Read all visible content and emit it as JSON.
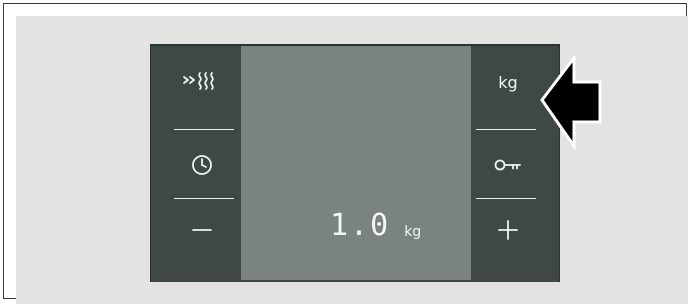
{
  "panel": {
    "left_buttons": [
      {
        "id": "speed",
        "icon": "speed-steam-icon",
        "label": "»≋"
      },
      {
        "id": "timer",
        "icon": "clock-icon",
        "label": ""
      },
      {
        "id": "minus",
        "icon": "minus-icon",
        "label": "—"
      }
    ],
    "right_buttons": [
      {
        "id": "weight",
        "icon": "weight-kg-icon",
        "label": "kg"
      },
      {
        "id": "lock",
        "icon": "key-lock-icon",
        "label": ""
      },
      {
        "id": "plus",
        "icon": "plus-icon",
        "label": "+"
      }
    ],
    "display": {
      "value": "1.0",
      "unit": "kg"
    }
  },
  "annotation": {
    "icon": "pointer-arrow-icon",
    "target": "weight"
  },
  "colors": {
    "background": "#e3e3e1",
    "panel": "#3f4846",
    "screen": "#7a8381",
    "symbol": "#f0f3f2",
    "arrow": "#000000"
  }
}
